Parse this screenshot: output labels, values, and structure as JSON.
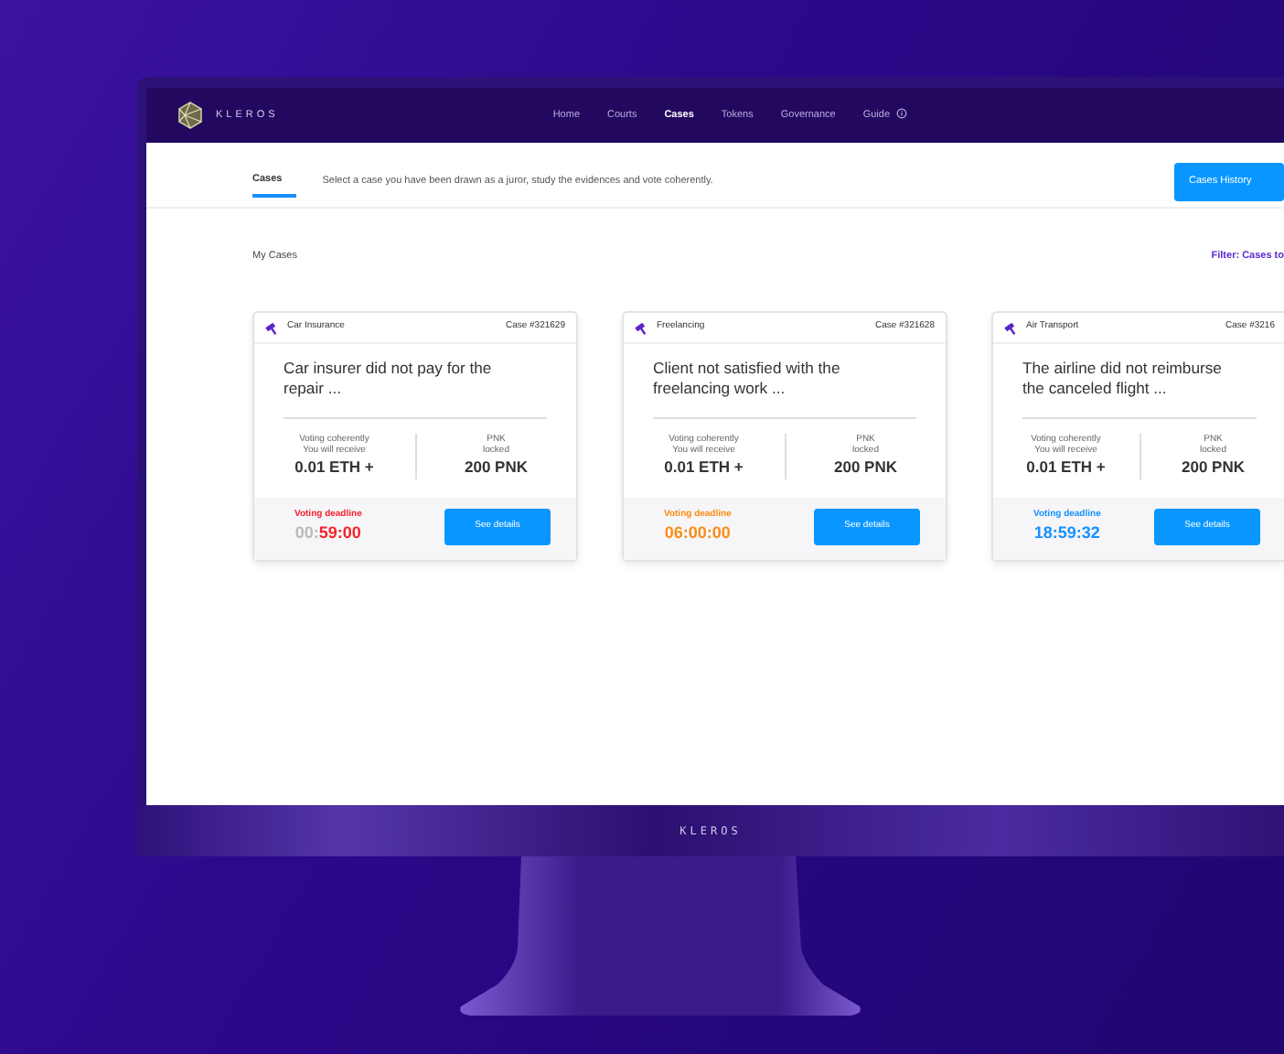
{
  "app": {
    "brand": "KLEROS",
    "nav": [
      {
        "label": "Home",
        "selected": false
      },
      {
        "label": "Courts",
        "selected": false
      },
      {
        "label": "Cases",
        "selected": true
      },
      {
        "label": "Tokens",
        "selected": false
      },
      {
        "label": "Governance",
        "selected": false
      },
      {
        "label": "Guide",
        "selected": false,
        "info": true
      }
    ]
  },
  "subheader": {
    "tabs": [
      {
        "label": "Cases",
        "selected": true
      }
    ],
    "description": "Select a case you have been drawn as a juror, study the evidences and vote coherently.",
    "history_button": "Cases History"
  },
  "section": {
    "title": "My Cases",
    "filter": "Filter: Cases to"
  },
  "cases": [
    {
      "category": "Car Insurance",
      "case_no": "Case #321629",
      "title": "Car insurer did not pay for the repair ...",
      "reward_caption": [
        "Voting coherently",
        "You will receive"
      ],
      "reward": "0.01 ETH +",
      "stake_caption": [
        "PNK",
        "locked"
      ],
      "stake": "200 PNK",
      "deadline_label": "Voting deadline",
      "time_faded": "00:",
      "time": "59:00",
      "color": "#f5222d",
      "button": "See details"
    },
    {
      "category": "Freelancing",
      "case_no": "Case #321628",
      "title": "Client not satisfied with the freelancing work ...",
      "reward_caption": [
        "Voting coherently",
        "You will receive"
      ],
      "reward": "0.01 ETH +",
      "stake_caption": [
        "PNK",
        "locked"
      ],
      "stake": "200 PNK",
      "deadline_label": "Voting deadline",
      "time": "06:00:00",
      "color": "#fa8c16",
      "button": "See details"
    },
    {
      "category": "Air Transport",
      "case_no": "Case #3216",
      "title": "The airline did not reimburse the canceled flight ...",
      "reward_caption": [
        "Voting coherently",
        "You will receive"
      ],
      "reward": "0.01 ETH +",
      "stake_caption": [
        "PNK",
        "locked"
      ],
      "stake": "200 PNK",
      "deadline_label": "Voting deadline",
      "time": "18:59:32",
      "color": "#1890ff",
      "button": "See details"
    }
  ],
  "monitor": {
    "label": "KLEROS"
  }
}
